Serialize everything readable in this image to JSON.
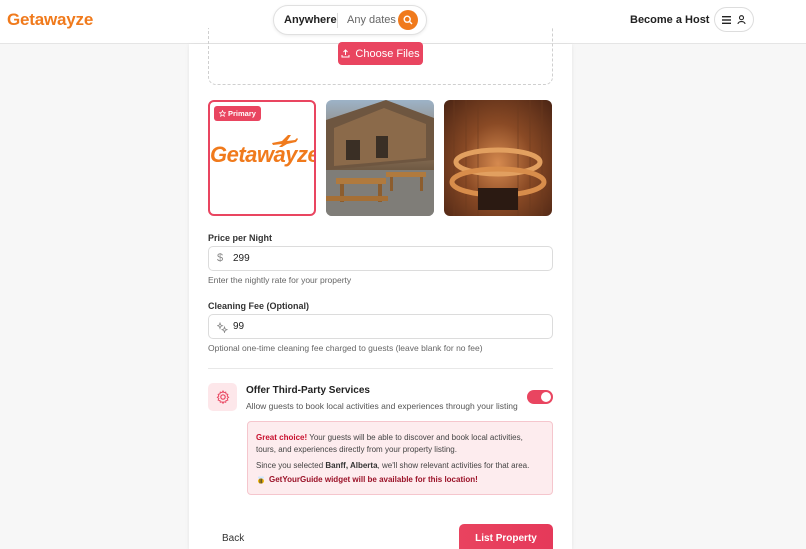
{
  "header": {
    "logo": "Getawayze",
    "search": {
      "location": "Anywhere",
      "dates": "Any dates"
    },
    "host_label": "Become a Host"
  },
  "upload": {
    "choose_files_label": "Choose Files"
  },
  "photos": {
    "primary_badge": "Primary",
    "logo_text": "Getawayze"
  },
  "price": {
    "label": "Price per Night",
    "currency_symbol": "$",
    "value": "299",
    "helper": "Enter the nightly rate for your property"
  },
  "cleaning": {
    "label": "Cleaning Fee (Optional)",
    "value": "99",
    "helper": "Optional one-time cleaning fee charged to guests (leave blank for no fee)"
  },
  "services": {
    "title": "Offer Third-Party Services",
    "subtitle": "Allow guests to book local activities and experiences through your listing",
    "enabled": true,
    "info": {
      "great_choice": "Great choice!",
      "line1_rest": " Your guests will be able to discover and book local activities,",
      "line2": "tours, and experiences directly from your property listing.",
      "line3_prefix": "Since you selected ",
      "location": "Banff, Alberta",
      "line3_suffix": ", we'll show relevant activities for that area.",
      "widget_note": "GetYourGuide widget will be available for this location!"
    }
  },
  "footer": {
    "back_label": "Back",
    "submit_label": "List Property"
  },
  "colors": {
    "brand": "#f07a1c",
    "accent": "#e94560"
  }
}
